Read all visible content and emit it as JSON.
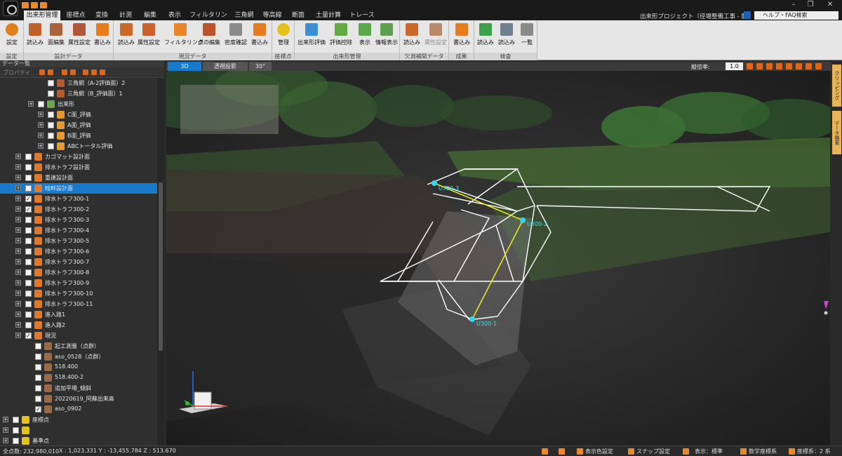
{
  "menu_tabs": [
    "出来形管理",
    "座標点",
    "変換",
    "計測",
    "編集",
    "表示",
    "フィルタリング",
    "三角網",
    "等高線",
    "断面",
    "土量計算",
    "トレース"
  ],
  "project_title": "出来形プロジェクト（径場整備工事 - 鷹）",
  "help_search": "ヘルプ・FAQ検索",
  "ribbon": {
    "groups": [
      "設定",
      "設計データ",
      "現況データ",
      "座標点",
      "出来形管理",
      "欠測補間データ",
      "成果",
      "検査"
    ],
    "buttons": [
      "設定",
      "読込み",
      "面編集",
      "属性設定",
      "書込み",
      "読込み",
      "属性設定",
      "フィルタリング",
      "点の編集",
      "密度確認",
      "書込み",
      "管理",
      "出来形評価",
      "評価控除",
      "表示",
      "情報表示",
      "読込み",
      "属性設定",
      "書込み",
      "読込み",
      "読込み",
      "一覧"
    ]
  },
  "data_panel": {
    "title": "データ一覧",
    "properties": "プロパティ",
    "tree": [
      {
        "label": "三角網（A-2評価面）2",
        "checked": false
      },
      {
        "label": "三角網（B_評価面）1",
        "checked": false
      },
      {
        "label": "出来形",
        "checked": false
      },
      {
        "label": "C面_評価",
        "checked": false
      },
      {
        "label": "A面_評価",
        "checked": false
      },
      {
        "label": "B面_評価",
        "checked": false
      },
      {
        "label": "ABCトータル評価",
        "checked": false
      },
      {
        "label": "カゴマット設計面",
        "checked": false
      },
      {
        "label": "排水トラフ設計面",
        "checked": false
      },
      {
        "label": "重連設計面",
        "checked": false
      },
      {
        "label": "畦畔設計面",
        "checked": false
      },
      {
        "label": "排水トラフ300-1",
        "checked": true
      },
      {
        "label": "排水トラフ300-2",
        "checked": true
      },
      {
        "label": "排水トラフ300-3",
        "checked": false
      },
      {
        "label": "排水トラフ300-4",
        "checked": false
      },
      {
        "label": "排水トラフ300-5",
        "checked": false
      },
      {
        "label": "排水トラフ300-6",
        "checked": false
      },
      {
        "label": "排水トラフ300-7",
        "checked": false
      },
      {
        "label": "排水トラフ300-8",
        "checked": false
      },
      {
        "label": "排水トラフ300-9",
        "checked": false
      },
      {
        "label": "排水トラフ300-10",
        "checked": false
      },
      {
        "label": "排水トラフ300-11",
        "checked": false
      },
      {
        "label": "進入路1",
        "checked": false
      },
      {
        "label": "進入路2",
        "checked": false
      },
      {
        "label": "現況",
        "checked": true
      },
      {
        "label": "起工測量（点群）",
        "checked": false
      },
      {
        "label": "aso_0528（点群）",
        "checked": false
      },
      {
        "label": "518.400",
        "checked": false
      },
      {
        "label": "518.400-2",
        "checked": false
      },
      {
        "label": "追加平場_傾斜",
        "checked": false
      },
      {
        "label": "20220619_阿蘇出来高",
        "checked": false
      },
      {
        "label": "aso_0902",
        "checked": true
      },
      {
        "label": "座標点",
        "checked": false
      },
      {
        "label": "",
        "checked": false
      },
      {
        "label": "基準点",
        "checked": false
      }
    ]
  },
  "viewport": {
    "tabs": [
      "3D",
      "透視投影",
      "30°"
    ],
    "zoom_label": "縦倍率:",
    "zoom_value": "1.0",
    "points": [
      "U300-1",
      "U300-2",
      "U300-3"
    ]
  },
  "right_tabs": [
    "クリッピング",
    "データ検索"
  ],
  "statusbar": {
    "point_count": "全点数: 232,980,010",
    "coords": "X : 1,023.331  Y : -13,455.784  Z : 513.670",
    "display_color": "表示色設定",
    "snap": "スナップ設定",
    "display": "表示：標準",
    "math_coords": "数学座標系",
    "coord_system": "座標系：2 系"
  },
  "colors": {
    "accent": "#1979ca",
    "ribbon_bg": "#e6e6e6",
    "selection": "#1979ca",
    "design_line": "#ffffff",
    "survey_line": "#e5e520",
    "point_marker": "#34d6e8"
  }
}
